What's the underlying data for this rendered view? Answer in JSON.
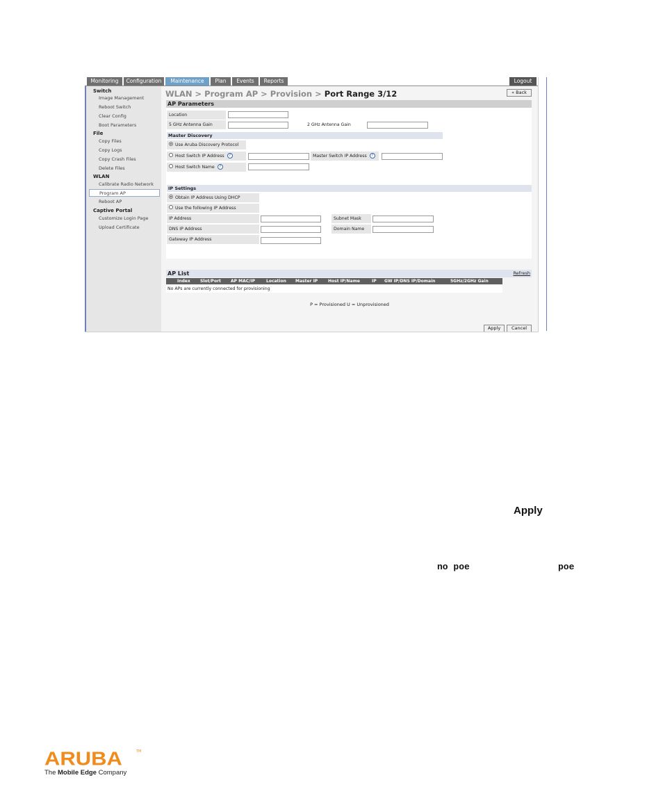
{
  "topnav": {
    "tabs": [
      "Monitoring",
      "Configuration",
      "Maintenance",
      "Plan",
      "Events",
      "Reports"
    ],
    "active": "Maintenance",
    "logout": "Logout"
  },
  "sidebar": {
    "switch": {
      "title": "Switch",
      "items": [
        "Image Management",
        "Reboot Switch",
        "Clear Config",
        "Boot Parameters"
      ]
    },
    "file": {
      "title": "File",
      "items": [
        "Copy Files",
        "Copy Logs",
        "Copy Crash Files",
        "Delete Files"
      ]
    },
    "wlan": {
      "title": "WLAN",
      "items": [
        "Calibrate Radio Network",
        "Program AP",
        "Reboot AP"
      ]
    },
    "captive": {
      "title": "Captive Portal",
      "items": [
        "Customize Login Page",
        "Upload Certificate"
      ]
    }
  },
  "breadcrumb": {
    "path": "WLAN > Program AP > Provision > ",
    "current": "Port Range 3/12"
  },
  "back_button": "« Back",
  "ap_params": {
    "title": "AP Parameters",
    "location": "Location",
    "gain5": "5 GHz Antenna Gain",
    "gain2": "2 GHz Antenna Gain"
  },
  "master_discovery": {
    "title": "Master Discovery",
    "use_adp": "Use Aruba Discovery Protocol",
    "host_ip": "Host Switch IP Address",
    "master_ip": "Master Switch IP Address",
    "host_name": "Host Switch Name",
    "help": "?"
  },
  "ip_settings": {
    "title": "IP Settings",
    "dhcp": "Obtain IP Address Using DHCP",
    "static": "Use the following IP Address",
    "ip": "IP Address",
    "subnet": "Subnet Mask",
    "dns": "DNS IP Address",
    "domain": "Domain Name",
    "gateway": "Gateway IP Address"
  },
  "ap_list": {
    "title": "AP List",
    "refresh": "Refresh",
    "columns": [
      "Index",
      "Slot/Port",
      "AP MAC/IP",
      "Location",
      "Master IP",
      "Host IP/Name",
      "IP",
      "GW IP/DNS IP/Domain",
      "5GHz/2GHz Gain"
    ],
    "empty": "No APs are currently connected for provisioning",
    "legend": "P = Provisioned U = Unprovisioned"
  },
  "buttons": {
    "apply": "Apply",
    "cancel": "Cancel"
  },
  "document": {
    "apply_word": "Apply",
    "code1": "no poe",
    "code2": "poe"
  },
  "logo": {
    "word": "ARUBA",
    "tm": "TM",
    "tag_pre": "The ",
    "tag_bold": "Mobile Edge",
    "tag_post": " Company"
  },
  "colors": {
    "nav_active": "#6ea0c8",
    "sidebar_border": "#6f7fb8",
    "brand_orange": "#f08c1e"
  }
}
